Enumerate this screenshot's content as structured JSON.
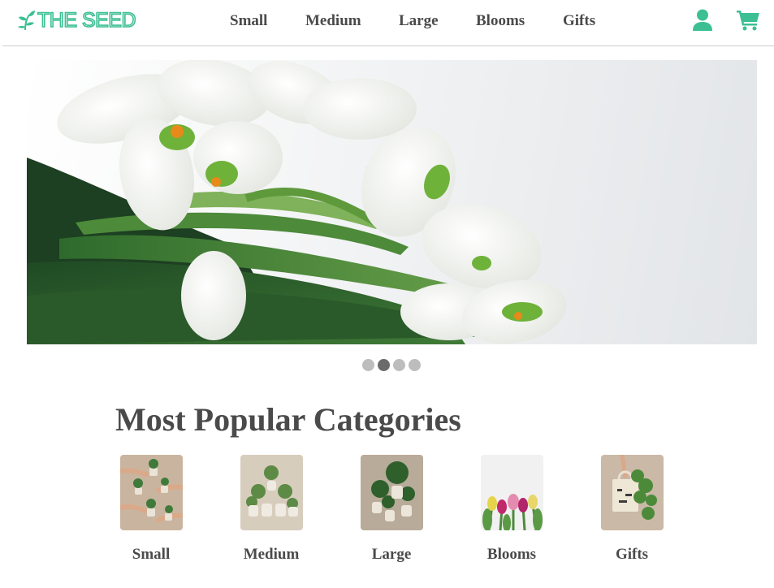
{
  "brand": {
    "name": "THE SEED",
    "logo_icon": "sprout-icon",
    "color": "#3cbf93"
  },
  "nav": {
    "items": [
      {
        "label": "Small"
      },
      {
        "label": "Medium"
      },
      {
        "label": "Large"
      },
      {
        "label": "Blooms"
      },
      {
        "label": "Gifts"
      }
    ]
  },
  "header_icons": {
    "account": "user-icon",
    "cart": "cart-icon",
    "color": "#3cbf93"
  },
  "hero": {
    "image": "white-snowdrop-flowers-photo",
    "slides_total": 4,
    "active_slide": 2
  },
  "categories": {
    "title": "Most Popular Categories",
    "items": [
      {
        "label": "Small",
        "image": "small-plants-in-hands-photo"
      },
      {
        "label": "Medium",
        "image": "medium-plants-group-photo"
      },
      {
        "label": "Large",
        "image": "large-plants-group-photo"
      },
      {
        "label": "Blooms",
        "image": "tulips-photo"
      },
      {
        "label": "Gifts",
        "image": "tote-bag-with-plant-photo"
      }
    ]
  },
  "colors": {
    "text": "#4a4a4a",
    "accent": "#3cbf93",
    "dot_inactive": "#bdbdbd",
    "dot_active": "#6b6b6b"
  }
}
